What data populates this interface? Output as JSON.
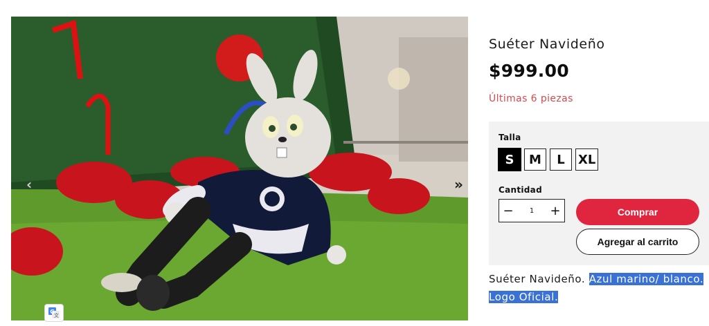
{
  "product": {
    "title": "Suéter Navideño",
    "price": "$999.00",
    "stock_note": "Últimas 6 piezas",
    "accent_color": "#e0253e",
    "stock_color": "#d9484e"
  },
  "options": {
    "size_label": "Talla",
    "sizes": [
      "S",
      "M",
      "L",
      "XL"
    ],
    "selected_size": "S",
    "quantity_label": "Cantidad",
    "quantity_value": "1",
    "decrement_symbol": "−",
    "increment_symbol": "+"
  },
  "actions": {
    "buy_label": "Comprar",
    "add_to_cart_label": "Agregar al carrito"
  },
  "description": {
    "plain": "Suéter Navideño.",
    "highlight_1": "Azul marino/ blanco.",
    "highlight_2": "Logo Oficial."
  },
  "gallery": {
    "prev_icon": "chevron-left-icon",
    "next_icon": "double-chevron-right-icon",
    "next_symbol": "»",
    "prev_symbol": "‹",
    "translate_icon": "google-translate-icon"
  }
}
